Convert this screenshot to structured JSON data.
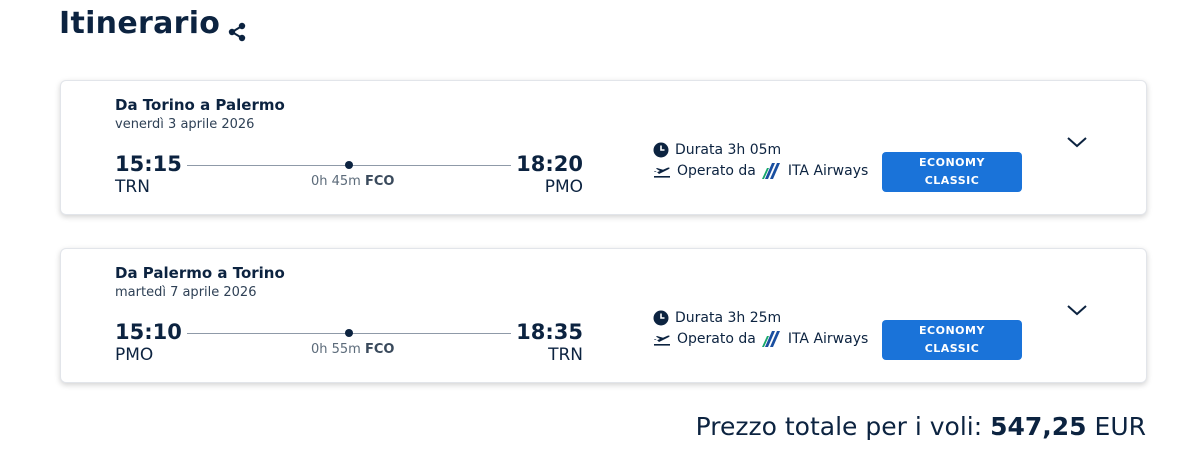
{
  "header": {
    "title": "Itinerario",
    "share_icon": "share-icon"
  },
  "flights": [
    {
      "route": "Da Torino a Palermo",
      "date": "venerdì 3 aprile 2026",
      "departure": {
        "time": "15:15",
        "code": "TRN"
      },
      "arrival": {
        "time": "18:20",
        "code": "PMO"
      },
      "stop": {
        "layover": "0h 45m",
        "airport": "FCO"
      },
      "duration": "Durata 3h 05m",
      "operated_by_label": "Operato da",
      "airline": "ITA Airways",
      "fare": {
        "line1": "ECONOMY",
        "line2": "CLASSIC"
      }
    },
    {
      "route": "Da Palermo a Torino",
      "date": "martedì 7 aprile 2026",
      "departure": {
        "time": "15:10",
        "code": "PMO"
      },
      "arrival": {
        "time": "18:35",
        "code": "TRN"
      },
      "stop": {
        "layover": "0h 55m",
        "airport": "FCO"
      },
      "duration": "Durata 3h 25m",
      "operated_by_label": "Operato da",
      "airline": "ITA Airways",
      "fare": {
        "line1": "ECONOMY",
        "line2": "CLASSIC"
      }
    }
  ],
  "total": {
    "label": "Prezzo totale per i voli:",
    "amount": "547,25",
    "currency": "EUR"
  },
  "colors": {
    "navy": "#0c2340",
    "accent": "#1a73d9",
    "ita_blue": "#1a4fa0",
    "ita_green": "#17a86b"
  }
}
